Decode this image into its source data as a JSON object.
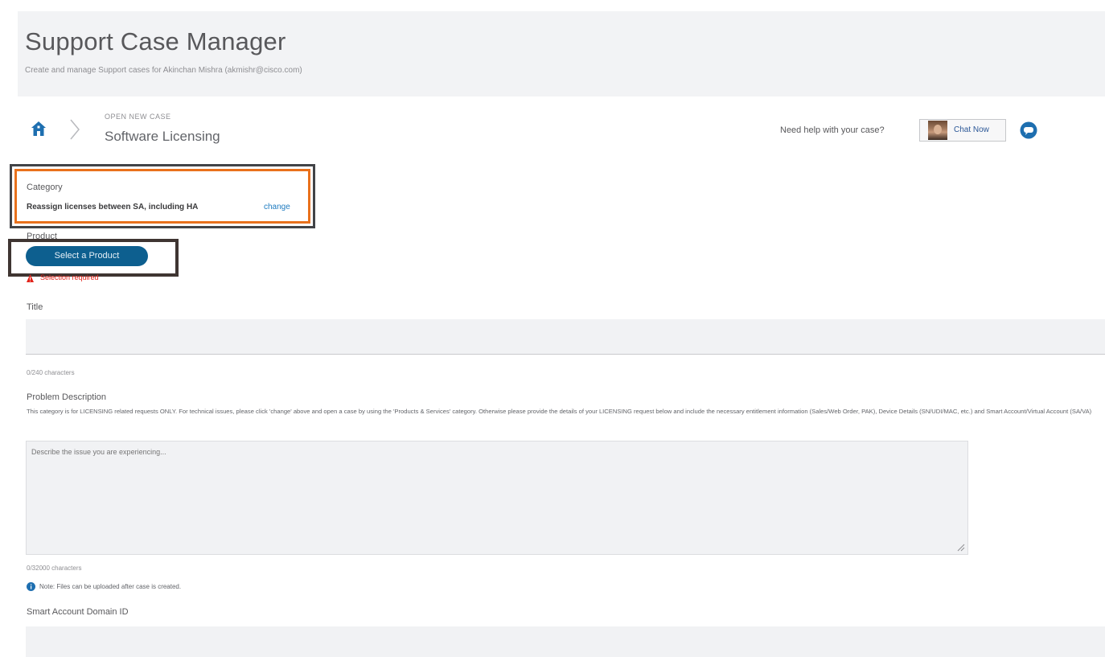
{
  "header": {
    "title": "Support Case Manager",
    "subtitle": "Create and manage Support cases for Akinchan Mishra (akmishr@cisco.com)"
  },
  "breadcrumb": {
    "caption": "OPEN NEW CASE",
    "title": "Software Licensing"
  },
  "help": {
    "text": "Need help with your case?",
    "chat_label": "Chat Now"
  },
  "category": {
    "label": "Category",
    "value": "Reassign licenses between SA, including HA",
    "change_label": "change"
  },
  "product": {
    "label": "Product",
    "button_label": "Select a Product",
    "error_text": "Selection required"
  },
  "title_field": {
    "label": "Title",
    "value": "",
    "counter": "0/240 characters"
  },
  "problem": {
    "label": "Problem Description",
    "help_text": "This category is for LICENSING related requests ONLY. For technical issues, please click 'change' above and open a case by using the 'Products & Services' category. Otherwise please provide the details of your LICENSING request below and include the necessary entitlement information (Sales/Web Order, PAK), Device Details (SN/UDI/MAC, etc.) and Smart Account/Virtual Account (SA/VA)",
    "placeholder": "Describe the issue you are experiencing...",
    "counter": "0/32000 characters"
  },
  "note": {
    "text": "Note: Files can be uploaded after case is created."
  },
  "smart_account": {
    "label": "Smart Account Domain ID",
    "value": ""
  },
  "colors": {
    "accent_blue": "#0d5f8f",
    "highlight_orange": "#e9711c",
    "error_red": "#e2231a",
    "link_blue": "#1e7bc0"
  },
  "icons": {
    "home": "home-icon",
    "breadcrumb_separator": "chevron-right-icon",
    "chat": "chat-bubble-icon",
    "warning": "warning-icon",
    "info": "info-icon"
  }
}
